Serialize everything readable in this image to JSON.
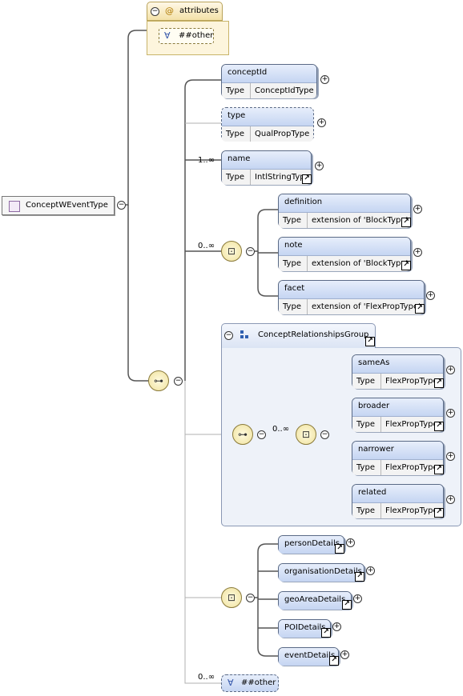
{
  "colors": {
    "element_header_top": "#e7eefb",
    "element_header_bottom": "#c5d5f2",
    "group_fill": "#eef2f9",
    "attributes_fill": "#fdf5dd",
    "root_fill": "#f3eaf7",
    "wire": "#555555"
  },
  "root": {
    "label": "ConceptWEventType"
  },
  "attributes": {
    "label": "attributes",
    "any": "##other"
  },
  "type_label": "Type",
  "elements": {
    "conceptId": {
      "name": "conceptId",
      "type": "ConceptIdType"
    },
    "type": {
      "name": "type",
      "type": "QualPropType"
    },
    "name": {
      "name": "name",
      "type": "IntlStringType",
      "card": "1..∞"
    },
    "definition": {
      "name": "definition",
      "type": "extension of 'BlockType'"
    },
    "note": {
      "name": "note",
      "type": "extension of 'BlockType'"
    },
    "facet": {
      "name": "facet",
      "type": "extension of 'FlexPropType'"
    }
  },
  "choice1_card": "0..∞",
  "group": {
    "label": "ConceptRelationshipsGroup",
    "choice_card": "0..∞",
    "items": [
      {
        "name": "sameAs",
        "type": "FlexPropType"
      },
      {
        "name": "broader",
        "type": "FlexPropType"
      },
      {
        "name": "narrower",
        "type": "FlexPropType"
      },
      {
        "name": "related",
        "type": "FlexPropType"
      }
    ]
  },
  "details": [
    "personDetails",
    "organisationDetails",
    "geoAreaDetails",
    "POIDetails",
    "eventDetails"
  ],
  "any_other": {
    "label": "##other",
    "card": "0..∞"
  },
  "icons": {
    "root": "complex-type-icon",
    "sequence": "sequence-icon",
    "choice": "choice-icon",
    "group": "group-icon",
    "link": "link-arrow-icon"
  }
}
